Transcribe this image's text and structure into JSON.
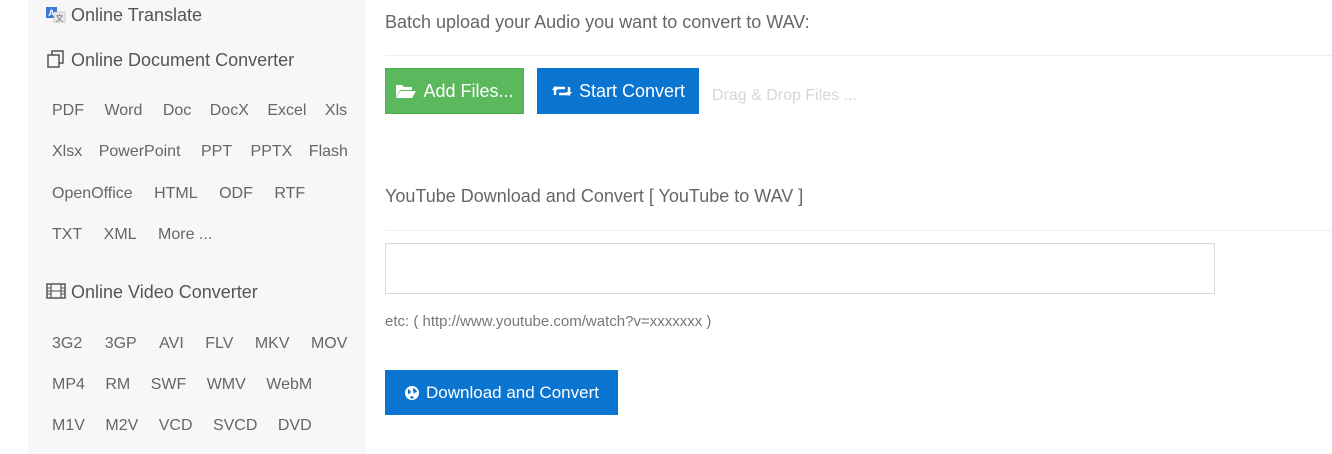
{
  "sidebar": {
    "translate": {
      "label": "Online Translate",
      "icon": "translate-icon"
    },
    "document": {
      "label": "Online Document Converter",
      "icon": "copy-icon",
      "rows": [
        [
          "PDF",
          "Word",
          "Doc",
          "DocX",
          "Excel",
          "Xls"
        ],
        [
          "Xlsx",
          "PowerPoint",
          "PPT",
          "PPTX",
          "Flash"
        ],
        [
          "OpenOffice",
          "HTML",
          "ODF",
          "RTF"
        ],
        [
          "TXT",
          "XML",
          "More ..."
        ]
      ]
    },
    "video": {
      "label": "Online Video Converter",
      "icon": "film-icon",
      "rows": [
        [
          "3G2",
          "3GP",
          "AVI",
          "FLV",
          "MKV",
          "MOV"
        ],
        [
          "MP4",
          "RM",
          "SWF",
          "WMV",
          "WebM"
        ],
        [
          "M1V",
          "M2V",
          "VCD",
          "SVCD",
          "DVD"
        ]
      ]
    }
  },
  "main": {
    "batch_heading": "Batch upload your Audio you want to convert to WAV:",
    "add_files_label": "Add Files...",
    "start_convert_label": "Start Convert",
    "drag_drop_hint": "Drag & Drop Files ...",
    "youtube_heading": "YouTube Download and Convert [ YouTube to WAV ]",
    "url_input_value": "",
    "url_example": "etc: ( http://www.youtube.com/watch?v=xxxxxxx )",
    "download_label": "Download and Convert"
  },
  "colors": {
    "green_button": "#5cb85c",
    "blue_button": "#0a74d1",
    "sidebar_bg": "#f7f7f7"
  }
}
